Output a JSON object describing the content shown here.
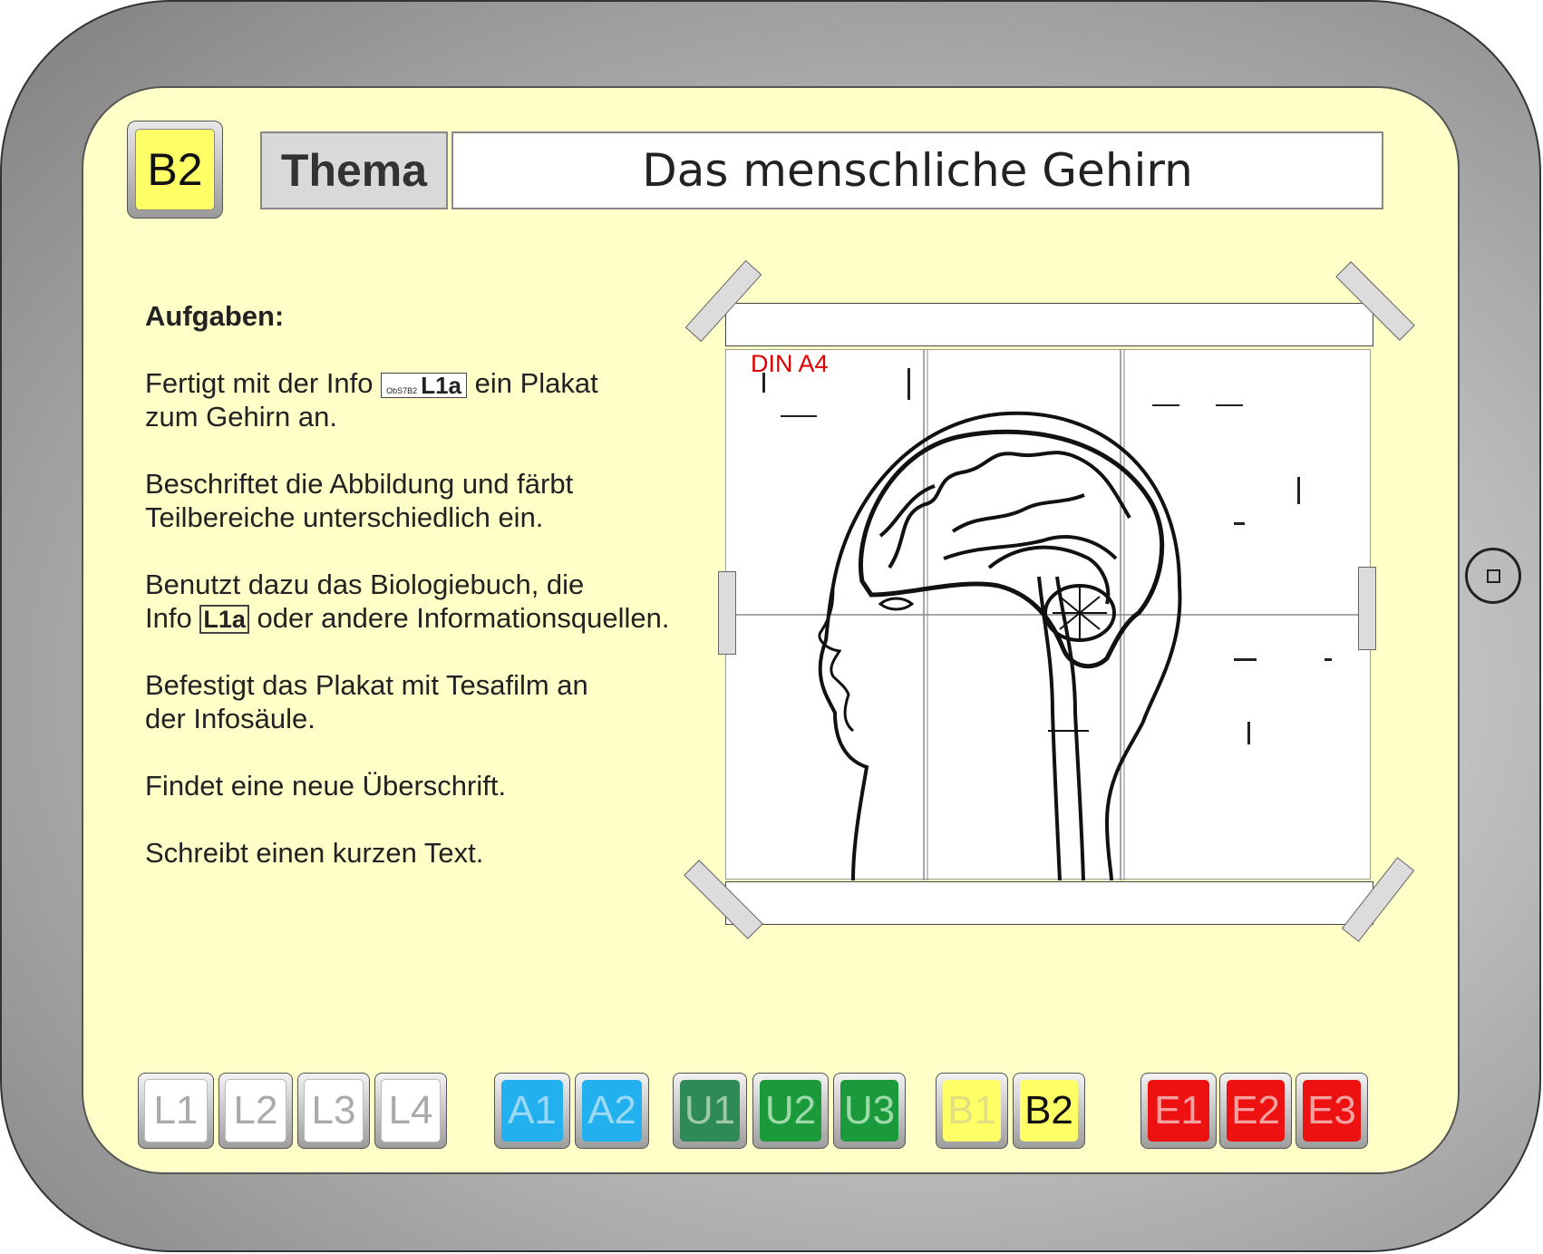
{
  "header": {
    "level_badge": "B2",
    "thema_label": "Thema",
    "title": "Das menschliche Gehirn"
  },
  "tasks": {
    "heading": "Aufgaben:",
    "t1_before": "Fertigt mit der Info",
    "t1_ref_small": "ObS7B2",
    "t1_ref": "L1a",
    "t1_after": "ein Plakat",
    "t1_line2": "zum Gehirn an.",
    "t2_line1": "Beschriftet die Abbildung und färbt",
    "t2_line2": "Teilbereiche unterschiedlich ein.",
    "t3_line1": "Benutzt dazu das Biologiebuch, die",
    "t3_before": "Info",
    "t3_ref": "L1a",
    "t3_after": "oder andere Informationsquellen.",
    "t4_line1": "Befestigt das Plakat mit Tesafilm an",
    "t4_line2": "der Infosäule.",
    "t5": "Findet eine neue Überschrift.",
    "t6": "Schreibt einen kurzen Text."
  },
  "poster": {
    "din_label": "DIN A4"
  },
  "nav": {
    "L1": "L1",
    "L2": "L2",
    "L3": "L3",
    "L4": "L4",
    "A1": "A1",
    "A2": "A2",
    "U1": "U1",
    "U2": "U2",
    "U3": "U3",
    "B1": "B1",
    "B2": "B2",
    "E1": "E1",
    "E2": "E2",
    "E3": "E3"
  },
  "colors": {
    "screen_bg": "#ffffc8",
    "level_yellow": "#ffff66",
    "a_blue": "#22b0ee",
    "u_green": "#1a9a3a",
    "e_red": "#ee1111"
  }
}
